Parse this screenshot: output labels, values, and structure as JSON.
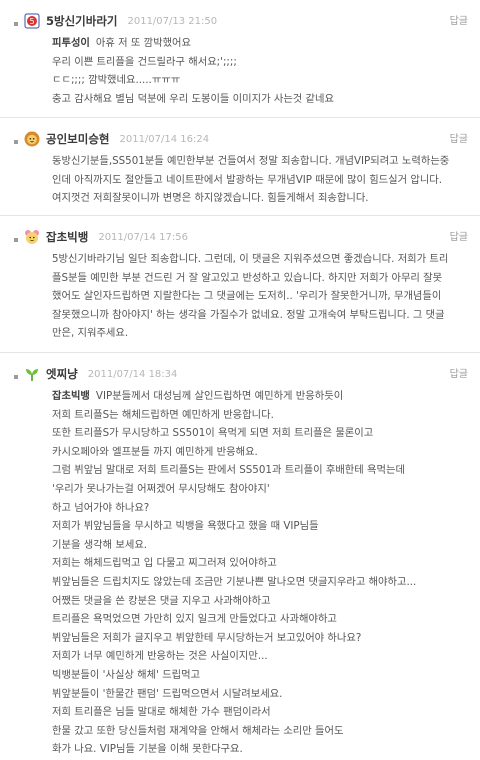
{
  "posts": [
    {
      "nickname": "5방신기바라기",
      "date": "2011/07/13 21:50",
      "reply_label": "답글",
      "avatar_icon": "badge-icon",
      "lines": [
        {
          "mention": "피투성이",
          "text": "아휴 저 또 깜박했어요"
        },
        {
          "mention": "",
          "text": "우리 이쁜 트리플을 건드릴라구 해서요;';;;;"
        },
        {
          "mention": "",
          "text": "ㄷㄷ;;;; 깜박했네요.....ㅠㅠㅠ"
        },
        {
          "mention": "",
          "text": "충고 감사해요 별님 덕분에 우리 도봉이들 이미지가 사는것 같네요"
        }
      ]
    },
    {
      "nickname": "공인보미승현",
      "date": "2011/07/14 16:24",
      "reply_label": "답글",
      "avatar_icon": "lion-face-icon",
      "lines": [
        {
          "mention": "",
          "text": "동방신기분들,SS501분들 예민한부분 건들여서 정말 죄송합니다. 개념VIP되려고 노력하는중"
        },
        {
          "mention": "",
          "text": "인데 아직까지도 절안들고 네이트판에서 발광하는 무개념VIP 때문에 많이 힘드실거 압니다."
        },
        {
          "mention": "",
          "text": "여지껏건 저희잘못이니까 변명은 하지않겠습니다. 힘들게해서 죄송합니다."
        }
      ]
    },
    {
      "nickname": "잡초빅뱅",
      "date": "2011/07/14 17:56",
      "reply_label": "답글",
      "avatar_icon": "flower-face-icon",
      "lines": [
        {
          "mention": "",
          "text": "5방신기바라기님 일단 죄송합니다. 그런데, 이 댓글은 지워주셨으면 좋겠습니다. 저희가 트리"
        },
        {
          "mention": "",
          "text": "플S분들 예민한 부분 건드린 거 잘 알고있고 반성하고 있습니다. 하지만 저희가 아무리 잘못"
        },
        {
          "mention": "",
          "text": "했어도 살인자드립하면 지랄한다는 그 댓글에는 도저히.. '우리가 잘못한거니까, 무개념들이"
        },
        {
          "mention": "",
          "text": "잘못했으니까 참아야지' 하는 생각을 가질수가 없네요. 정말 고개숙여 부탁드립니다. 그 댓글"
        },
        {
          "mention": "",
          "text": "만은, 지워주세요."
        }
      ]
    },
    {
      "nickname": "엣찌냥",
      "date": "2011/07/14 18:34",
      "reply_label": "답글",
      "avatar_icon": "sprout-icon",
      "lines": [
        {
          "mention": "잡초빅뱅",
          "text": "VIP분들께서 대성님께 살인드립하면 예민하게 반응하듯이"
        },
        {
          "mention": "",
          "text": "저희 트리플S는 해체드립하면 예민하게 반응합니다."
        },
        {
          "mention": "",
          "text": "또한 트리플S가 무시당하고 SS501이 욕먹게 되면 저희 트리플은 물론이고"
        },
        {
          "mention": "",
          "text": "카시오페아와 엘프분들 까지 예민하게 반응해요."
        },
        {
          "mention": "",
          "text": "그럼 뷔앞님 말대로 저희 트리플S는 판에서 SS501과 트리플이 후배한테 욕먹는데"
        },
        {
          "mention": "",
          "text": "'우리가 못나가는걸 어쩌겠어 무시당해도 참아야지'"
        },
        {
          "mention": "",
          "text": "하고 넘어가야 하나요?"
        },
        {
          "mention": "",
          "text": "저희가 뷔앞님들을 무시하고 빅뱅을 욕했다고 했을 때 VIP님들"
        },
        {
          "mention": "",
          "text": "기분을 생각해 보세요."
        },
        {
          "mention": "",
          "text": "저희는 해체드립먹고 입 다물고 찌그러져 있어야하고"
        },
        {
          "mention": "",
          "text": "뷔앞님들은 드립치지도 않았는데 조금만 기분나쁜 말나오면 댓글지우라고 해야하고..."
        },
        {
          "mention": "",
          "text": "어쨌든 댓글을 쓴 캉분은 댓글 지우고 사과해야하고"
        },
        {
          "mention": "",
          "text": "트리플은 욕먹었으면 가만히 있지 일크게 만들었다고 사과해야하고"
        },
        {
          "mention": "",
          "text": "뷔앞님들은 저희가 글지우고 뷔앞한테 무시당하는거 보고있어야 하나요?"
        },
        {
          "mention": "",
          "text": "저희가 너무 예민하게 반응하는 것은 사실이지만..."
        },
        {
          "mention": "",
          "text": "빅뱅분들이 '사실상 해체' 드립먹고"
        },
        {
          "mention": "",
          "text": "뷔앞분들이 '한물간 팬덤' 드립먹으면서 시달려보세요."
        },
        {
          "mention": "",
          "text": "저희 트리플은 님들 말대로 해체한 가수 팬덤이라서"
        },
        {
          "mention": "",
          "text": "한물 갔고 또한 당신들처럼 재계약을 안해서 해체라는 소리만 들어도"
        },
        {
          "mention": "",
          "text": "화가 나요. VIP님들 기분을 이해 못한다구요."
        }
      ]
    }
  ]
}
